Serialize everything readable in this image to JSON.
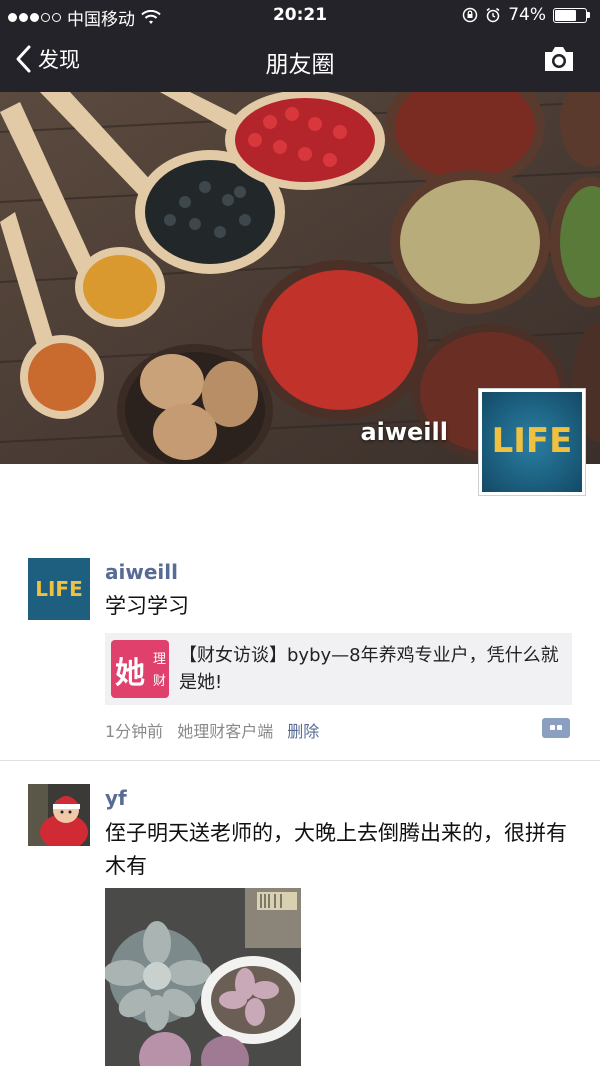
{
  "status_bar": {
    "carrier": "中国移动",
    "time": "20:21",
    "battery": "74%",
    "battery_level": 0.74,
    "signal_bars_filled": 3,
    "signal_bars_total": 5
  },
  "nav": {
    "back_label": "发现",
    "title": "朋友圈"
  },
  "cover": {
    "username": "aiweill",
    "avatar_text": "LIFE"
  },
  "posts": [
    {
      "name": "aiweill",
      "avatar_text": "LIFE",
      "text": "学习学习",
      "share": {
        "icon_main": "她",
        "icon_sub1": "理",
        "icon_sub2": "财",
        "title": "【财女访谈】byby—8年养鸡专业户，凭什么就是她!"
      },
      "time": "1分钟前",
      "source": "她理财客户端",
      "delete_label": "删除"
    },
    {
      "name": "yf",
      "text": "侄子明天送老师的，大晚上去倒腾出来的，很拼有木有"
    }
  ],
  "colors": {
    "nav_bg": "#25232a",
    "name_link": "#576b95",
    "share_icon": "#e0406c"
  }
}
